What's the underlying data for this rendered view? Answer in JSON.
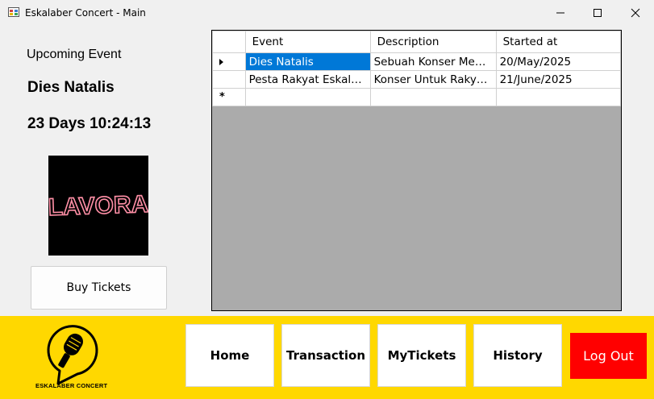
{
  "window": {
    "title": "Eskalaber Concert - Main"
  },
  "upcoming": {
    "heading": "Upcoming Event",
    "event_name": "Dies Natalis",
    "countdown": "23 Days 10:24:13",
    "poster_text": "LAVORA",
    "buy_label": "Buy Tickets"
  },
  "grid": {
    "columns": [
      "Event",
      "Description",
      "Started at"
    ],
    "rows": [
      {
        "event": "Dies Natalis",
        "description": "Sebuah Konser Mem…",
        "started": "20/May/2025"
      },
      {
        "event": "Pesta Rakyat Eskala…",
        "description": "Konser Untuk Rakyat…",
        "started": "21/June/2025"
      }
    ]
  },
  "brand": {
    "name": "ESKALABER CONCERT"
  },
  "nav": {
    "home": "Home",
    "transaction": "Transaction",
    "mytickets": "MyTickets",
    "history": "History",
    "logout": "Log Out"
  },
  "colors": {
    "accent_bar": "#ffd800",
    "logout": "#ff0000",
    "selection": "#0078d7"
  }
}
